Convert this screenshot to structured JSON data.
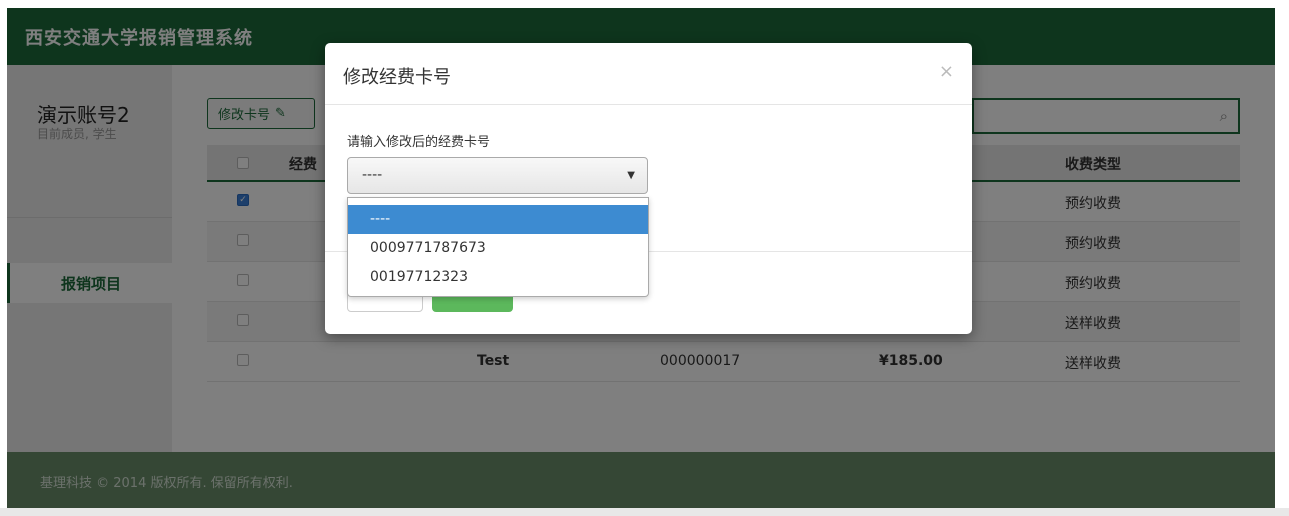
{
  "app": {
    "title": "西安交通大学报销管理系统"
  },
  "sidebar": {
    "user_name": "演示账号2",
    "user_role": "目前成员, 学生",
    "items": [
      {
        "label": "报销项目"
      }
    ]
  },
  "toolbar": {
    "edit_card_label": "修改卡号",
    "edit_icon": "edit-icon"
  },
  "search": {
    "icon": "search-icon"
  },
  "table": {
    "headers": {
      "col1": "经费",
      "col_type": "收费类型"
    },
    "rows": [
      {
        "checked": true,
        "name": "",
        "code": "",
        "amount": "",
        "type": "预约收费"
      },
      {
        "checked": false,
        "name": "",
        "code": "",
        "amount": "",
        "type": "预约收费"
      },
      {
        "checked": false,
        "name": "",
        "code": "",
        "amount": "",
        "type": "预约收费"
      },
      {
        "checked": false,
        "name": "",
        "code": "",
        "amount": "",
        "type": "送样收费"
      },
      {
        "checked": false,
        "name": "Test",
        "code": "000000017",
        "amount": "¥185.00",
        "type": "送样收费"
      }
    ]
  },
  "footer": {
    "text": "基理科技 © 2014 版权所有. 保留所有权利."
  },
  "modal": {
    "title": "修改经费卡号",
    "close": "×",
    "field_label": "请输入修改后的经费卡号",
    "select_value": "----",
    "options": [
      "----",
      "0009771787673",
      "00197712323"
    ],
    "selected_index": 0
  },
  "colors": {
    "brand": "#1d6b3b",
    "accent": "#3d8bd1",
    "ok": "#5cb85c"
  }
}
